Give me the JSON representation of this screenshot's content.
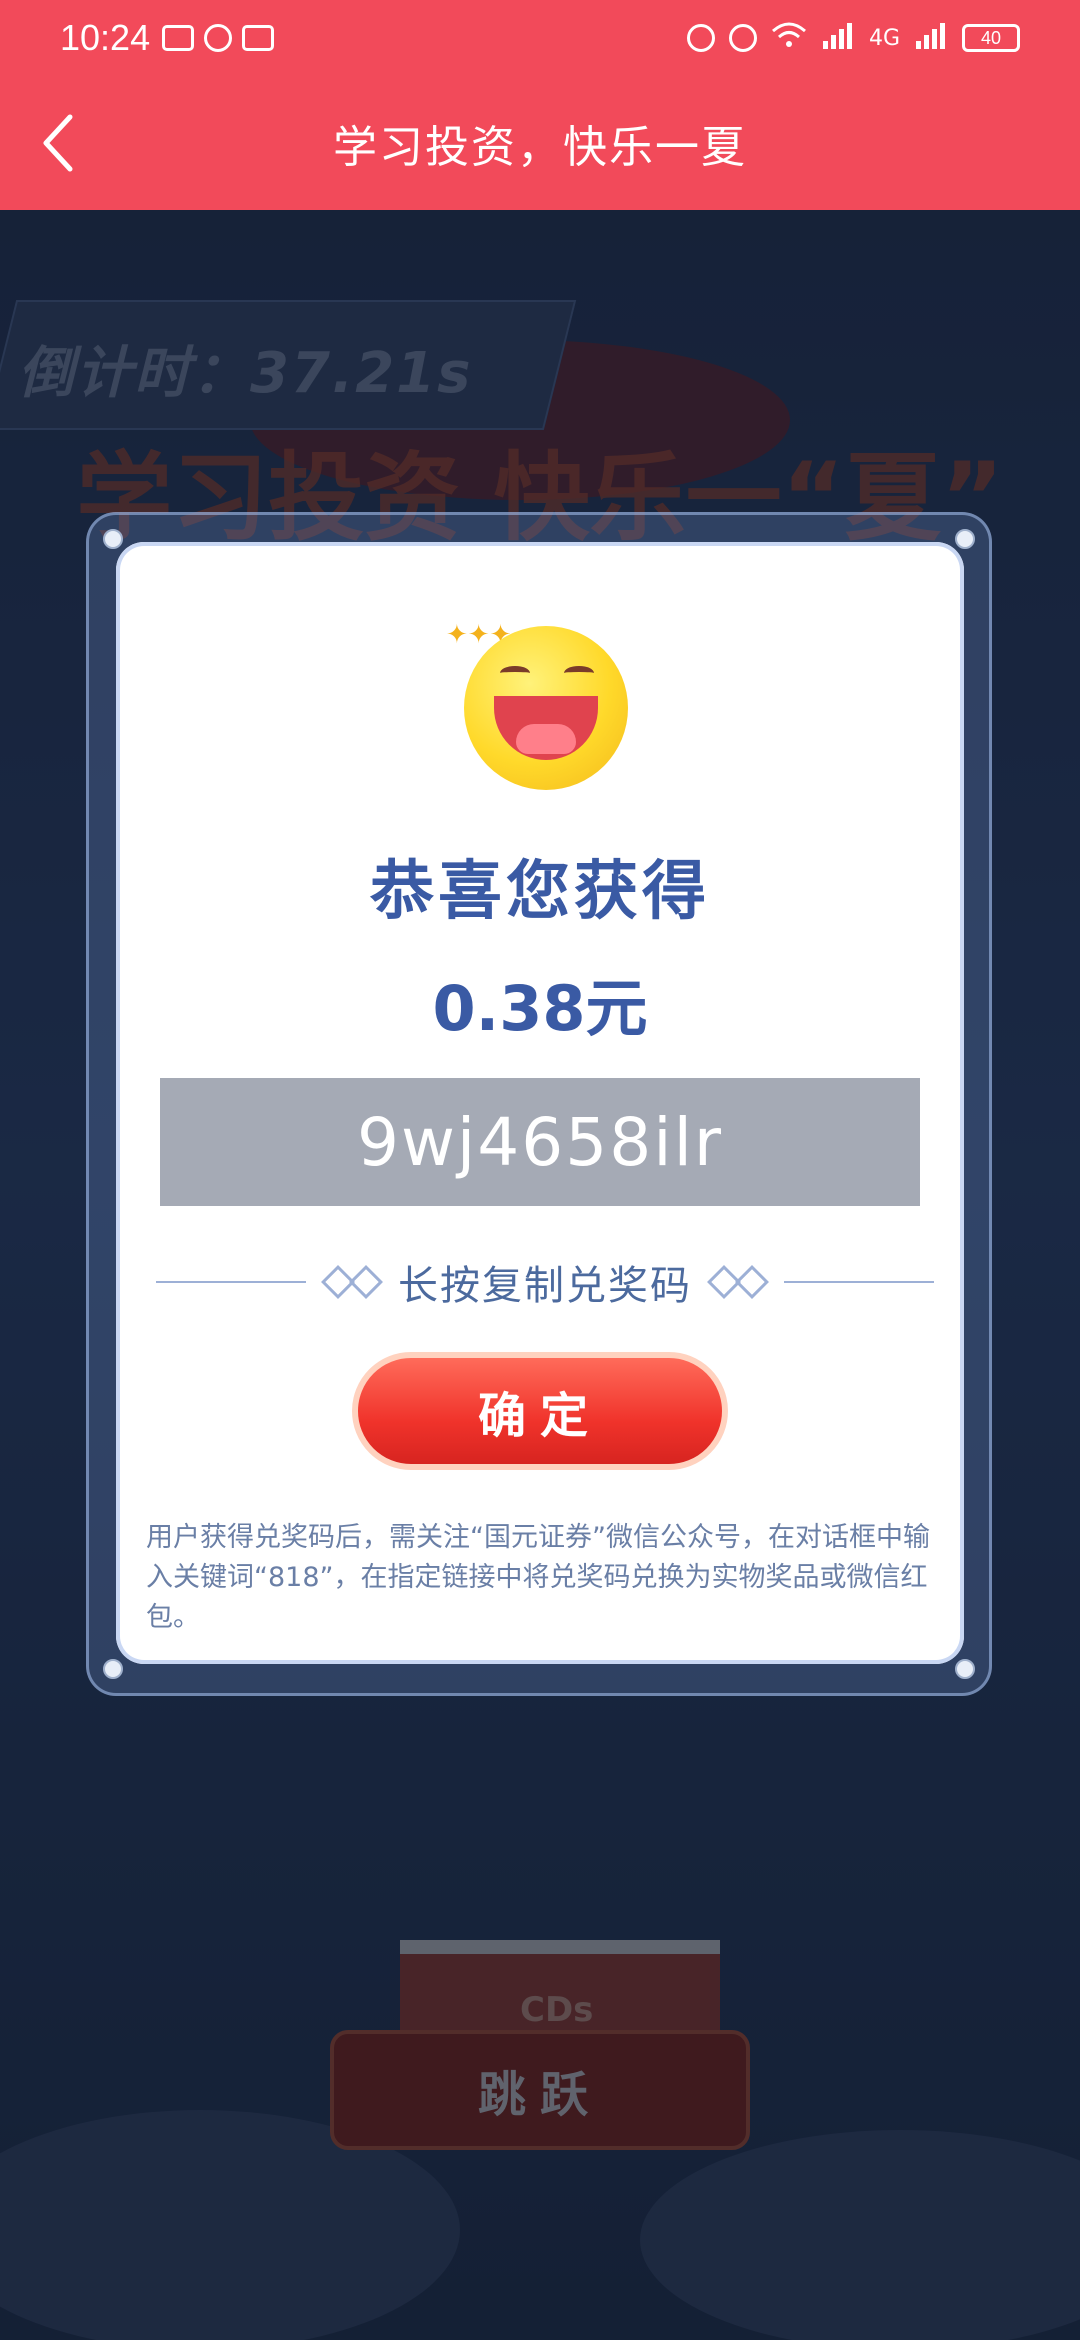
{
  "status_bar": {
    "time": "10:24",
    "battery": "40",
    "network": "4G"
  },
  "nav": {
    "title": "学习投资，快乐一夏"
  },
  "background": {
    "countdown": "倒计时：37.21s",
    "banner_title": "学习投资 快乐一“夏”",
    "platform_label": "CDs",
    "jump_button": "跳跃"
  },
  "modal": {
    "congrats": "恭喜您获得",
    "amount": "0.38元",
    "code": "9wj4658ilr",
    "copy_hint": "长按复制兑奖码",
    "confirm": "确定",
    "notice": "用户获得兑奖码后，需关注“国元证券”微信公众号，在对话框中输入关键词“818”，在指定链接中将兑奖码兑换为实物奖品或微信红包。"
  },
  "colors": {
    "brand_red": "#f24a5a",
    "title_blue": "#3a5aa4",
    "code_gray": "#a5aab5",
    "button_red": "#f0332b"
  }
}
